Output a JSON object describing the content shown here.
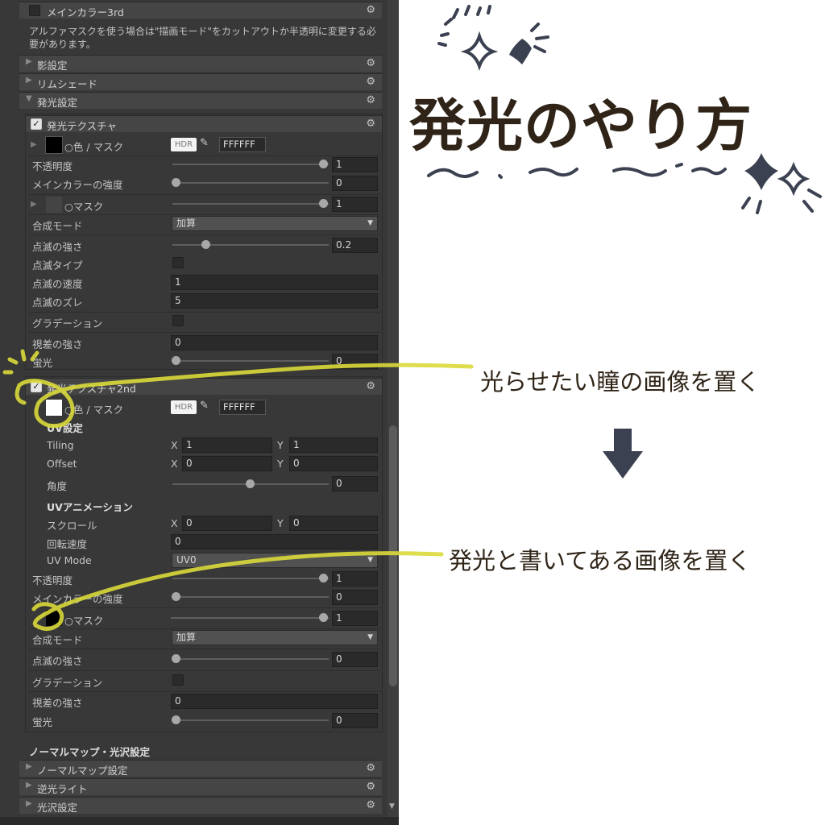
{
  "inspector": {
    "main_color_3rd": "メインカラー3rd",
    "alpha_note": "アルファマスクを使う場合は\"描画モード\"をカットアウトか半透明に変更する必要があります。",
    "shadow": "影設定",
    "rim": "リムシェード",
    "emission": "発光設定",
    "emission_tex": {
      "title": "発光テクスチャ",
      "color_mask": "○色 / マスク",
      "hdr": "HDR",
      "hex": "FFFFFF",
      "opacity_label": "不透明度",
      "opacity": "1",
      "main_strength_label": "メインカラーの強度",
      "main_strength": "0",
      "mask_label": "○マスク",
      "mask": "1",
      "blend_label": "合成モード",
      "blend": "加算",
      "blink_strength_label": "点滅の強さ",
      "blink_strength": "0.2",
      "blink_type_label": "点滅タイプ",
      "blink_speed_label": "点滅の速度",
      "blink_speed": "1",
      "blink_offset_label": "点滅のズレ",
      "blink_offset": "5",
      "gradation_label": "グラデーション",
      "parallax_label": "視差の強さ",
      "parallax": "0",
      "fluorescence_label": "蛍光",
      "fluorescence": "0"
    },
    "emission_tex2": {
      "title": "発光テクスチャ2nd",
      "color_mask": "○色 / マスク",
      "hdr": "HDR",
      "hex": "FFFFFF",
      "uv_settings": "UV設定",
      "tiling_label": "Tiling",
      "tiling_x": "1",
      "tiling_y": "1",
      "offset_label": "Offset",
      "offset_x": "0",
      "offset_y": "0",
      "angle_label": "角度",
      "angle": "0",
      "uv_anim": "UVアニメーション",
      "scroll_label": "スクロール",
      "scroll_x": "0",
      "scroll_y": "0",
      "rot_speed_label": "回転速度",
      "rot_speed": "0",
      "uv_mode_label": "UV Mode",
      "uv_mode": "UV0",
      "opacity_label": "不透明度",
      "opacity": "1",
      "main_strength_label": "メインカラーの強度",
      "main_strength": "0",
      "mask_label": "○マスク",
      "mask": "1",
      "blend_label": "合成モード",
      "blend": "加算",
      "blink_strength_label": "点滅の強さ",
      "blink_strength": "0",
      "gradation_label": "グラデーション",
      "parallax_label": "視差の強さ",
      "parallax": "0",
      "fluorescence_label": "蛍光",
      "fluorescence": "0"
    },
    "x": "X",
    "y": "Y",
    "normal_section": "ノーマルマップ・光沢設定",
    "normal_map": "ノーマルマップ設定",
    "backlight": "逆光ライト",
    "gloss": "光沢設定"
  },
  "annotation": {
    "title": "発光のやり方",
    "note1": "光らせたい瞳の画像を置く",
    "note2": "発光と書いてある画像を置く",
    "highlight_color": "#d9d93a",
    "ink_color": "#3b4150",
    "text_color": "#2f2417"
  }
}
